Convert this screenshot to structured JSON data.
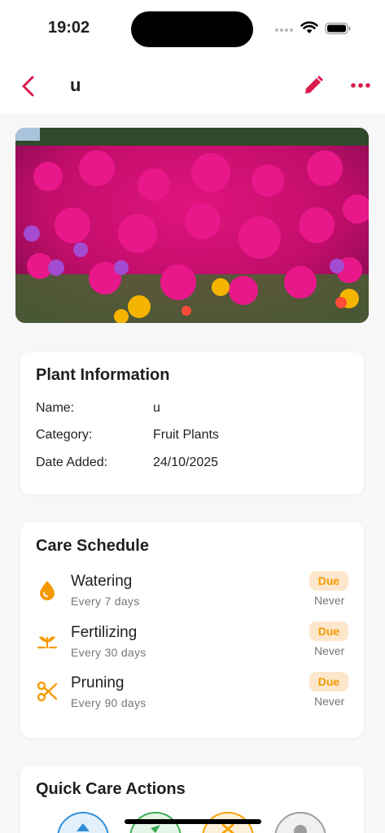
{
  "status_bar": {
    "time": "19:02"
  },
  "nav": {
    "title": "u"
  },
  "plant_info": {
    "title": "Plant Information",
    "rows": [
      {
        "label": "Name:",
        "value": "u"
      },
      {
        "label": "Category:",
        "value": "Fruit Plants"
      },
      {
        "label": "Date Added:",
        "value": "24/10/2025"
      }
    ]
  },
  "care_schedule": {
    "title": "Care Schedule",
    "items": [
      {
        "name": "Watering",
        "frequency": "Every 7 days",
        "badge": "Due",
        "last": "Never",
        "icon": "water-drop-icon"
      },
      {
        "name": "Fertilizing",
        "frequency": "Every 30 days",
        "badge": "Due",
        "last": "Never",
        "icon": "sprout-icon"
      },
      {
        "name": "Pruning",
        "frequency": "Every 90 days",
        "badge": "Due",
        "last": "Never",
        "icon": "scissors-icon"
      }
    ]
  },
  "quick_actions": {
    "title": "Quick Care Actions",
    "buttons": [
      {
        "icon": "water-action-icon",
        "color": "#2f8fdc"
      },
      {
        "icon": "fertilize-action-icon",
        "color": "#3cae52"
      },
      {
        "icon": "prune-action-icon",
        "color": "#f5a300"
      },
      {
        "icon": "more-action-icon",
        "color": "#9e9e9e"
      }
    ]
  },
  "colors": {
    "accent": "#d81b4a",
    "care_icon": "#f59a00",
    "badge_bg": "#fde7cc"
  }
}
